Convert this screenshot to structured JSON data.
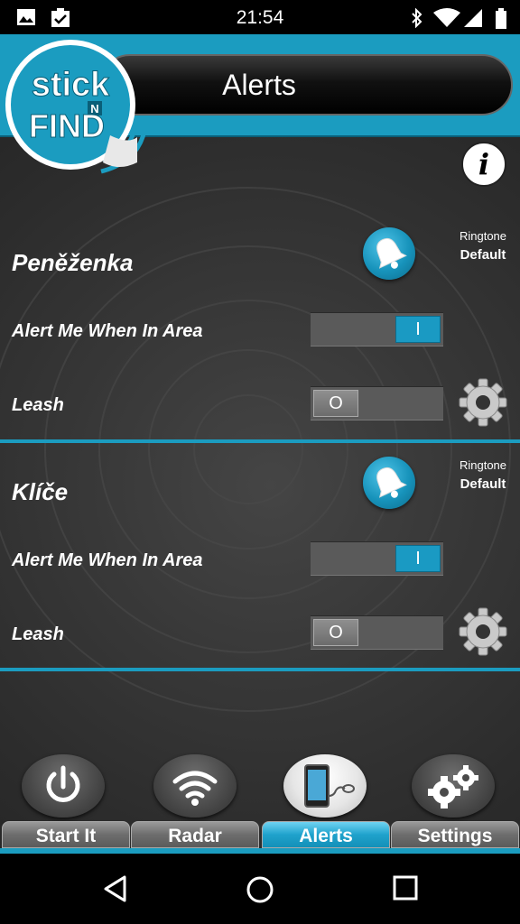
{
  "status_bar": {
    "time": "21:54",
    "left_icons": [
      "image-icon",
      "clipboard-check-icon"
    ],
    "right_icons": [
      "bluetooth-icon",
      "wifi-icon",
      "cell-signal-icon",
      "battery-icon"
    ]
  },
  "header": {
    "title": "Alerts",
    "logo": {
      "line1": "stick",
      "mid": "N",
      "line2": "FIND"
    }
  },
  "info_button": {
    "label": "i"
  },
  "devices": [
    {
      "name": "Peněženka",
      "ringtone_label": "Ringtone",
      "ringtone_value": "Default",
      "alert_label": "Alert Me When In Area",
      "alert_state": "I",
      "alert_on": true,
      "leash_label": "Leash",
      "leash_state": "O",
      "leash_on": false
    },
    {
      "name": "Klíče",
      "ringtone_label": "Ringtone",
      "ringtone_value": "Default",
      "alert_label": "Alert Me When In Area",
      "alert_state": "I",
      "alert_on": true,
      "leash_label": "Leash",
      "leash_state": "O",
      "leash_on": false
    }
  ],
  "tabs": [
    {
      "label": "Start It",
      "icon": "power-icon",
      "active": false
    },
    {
      "label": "Radar",
      "icon": "wifi-signal-icon",
      "active": false
    },
    {
      "label": "Alerts",
      "icon": "phone-link-icon",
      "active": true
    },
    {
      "label": "Settings",
      "icon": "gears-icon",
      "active": false
    }
  ],
  "nav_bar": {
    "icons": [
      "back-icon",
      "home-icon",
      "recents-icon"
    ]
  },
  "colors": {
    "accent": "#1b9cc0",
    "background": "#333333",
    "toggle_on": "#1a9ac3"
  }
}
